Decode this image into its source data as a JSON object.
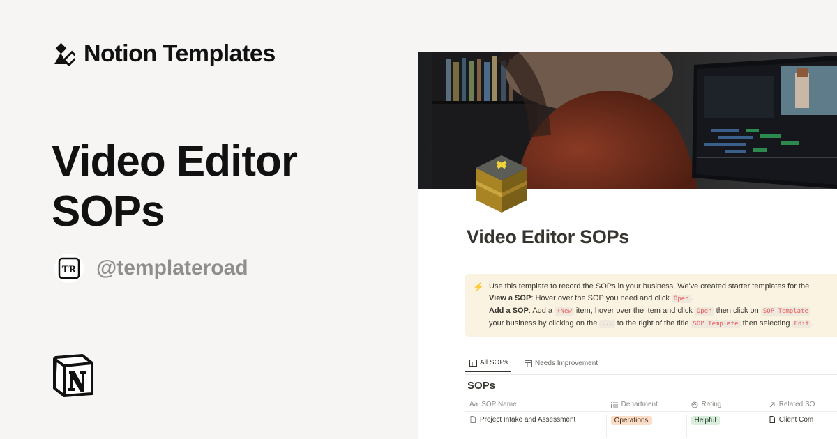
{
  "brand": {
    "title": "Notion Templates",
    "icon": "shapes-icon"
  },
  "hero": {
    "title": "Video Editor SOPs"
  },
  "author": {
    "handle": "@templateroad",
    "avatar_text": "TR"
  },
  "notion_logo": "notion-logo-icon",
  "page": {
    "title": "Video Editor SOPs",
    "icon": "cube-icon",
    "callout": {
      "icon": "lightning-icon",
      "line1": "Use this template to record the SOPs in your business. We've created starter templates for the",
      "view_label": "View a SOP",
      "view_text": ": Hover over the SOP you need and click",
      "open_code": "Open",
      "add_label": "Add a SOP",
      "add_text1": ": Add a",
      "new_code": "+New",
      "add_text2": "item, hover over the item and click",
      "open_code2": "Open",
      "add_text3": "then click on",
      "sop_template_code": "SOP Template",
      "line4_text1": "your business by clicking on the",
      "dots_code": "...",
      "line4_text2": "to the right of the title",
      "sop_template_code2": "SOP Template",
      "line4_text3": "then selecting",
      "edit_code": "Edit"
    },
    "tabs": [
      {
        "label": "All SOPs",
        "active": true
      },
      {
        "label": "Needs Improvement",
        "active": false
      }
    ],
    "database": {
      "title": "SOPs",
      "columns": [
        "SOP Name",
        "Department",
        "Rating",
        "Related SO"
      ],
      "column_icon_prefix": "Aa",
      "rows": [
        {
          "name": "Project Intake and Assessment",
          "department": "Operations",
          "rating": "Helpful",
          "related": "Client Com"
        }
      ]
    }
  },
  "colors": {
    "background": "#f6f5f4",
    "callout_bg": "#fbf3e2",
    "tag_orange": "#fadec9",
    "tag_green": "#dbeddb",
    "code_red": "#eb5757"
  }
}
